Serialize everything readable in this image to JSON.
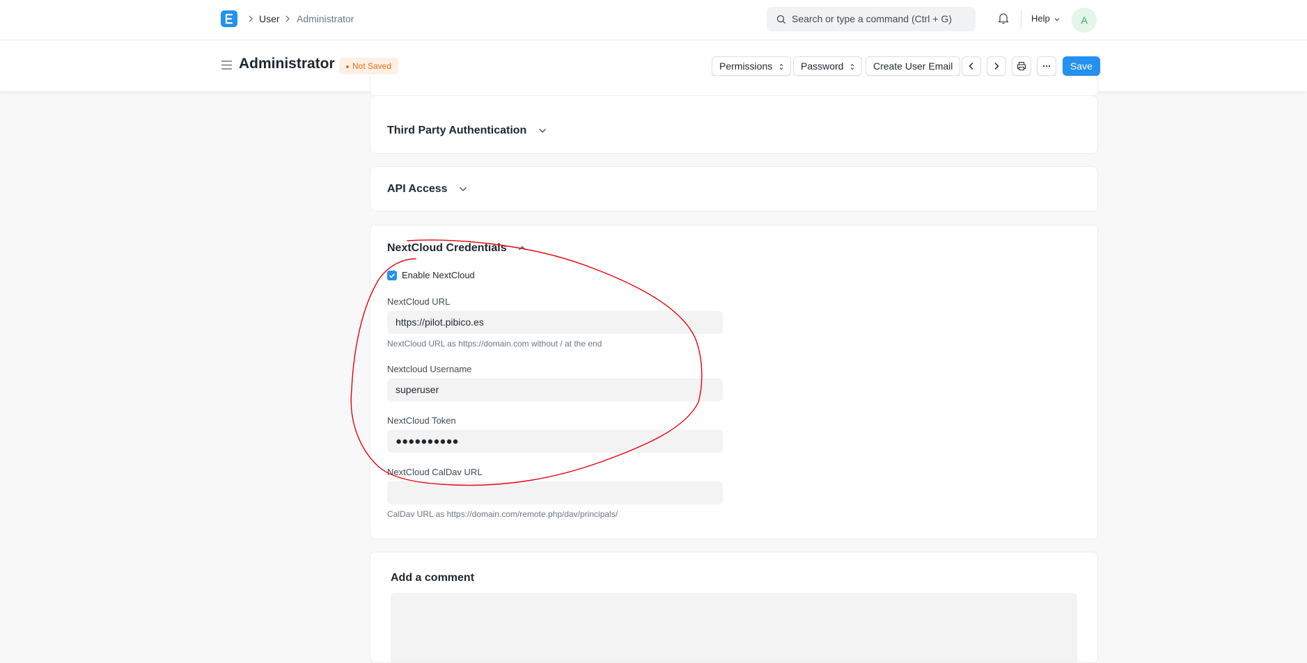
{
  "navbar": {
    "breadcrumbs": [
      "User",
      "Administrator"
    ],
    "search_placeholder": "Search or type a command (Ctrl + G)",
    "help_label": "Help",
    "avatar_initial": "A"
  },
  "page_head": {
    "title": "Administrator",
    "status": "Not Saved",
    "buttons": {
      "permissions": "Permissions",
      "password": "Password",
      "create_user_email": "Create User Email",
      "save": "Save"
    }
  },
  "sections": {
    "third_party": "Third Party Authentication",
    "api_access": "API Access",
    "nextcloud": {
      "title": "NextCloud Credentials",
      "enable_label": "Enable NextCloud",
      "enable_checked": true,
      "url_label": "NextCloud URL",
      "url_value": "https://pilot.pibico.es",
      "url_desc": "NextCloud URL as https://domain.com without / at the end",
      "username_label": "Nextcloud Username",
      "username_value": "superuser",
      "token_label": "NextCloud Token",
      "token_value": "●●●●●●●●●●",
      "caldav_label": "NextCloud CalDav URL",
      "caldav_value": "",
      "caldav_desc": "CalDav URL as https://domain.com/remote.php/dav/principals/"
    }
  },
  "comment": {
    "title": "Add a comment"
  },
  "colors": {
    "primary": "#2490ef",
    "annotation": "#e8000b",
    "not_saved": "#e86c13"
  }
}
